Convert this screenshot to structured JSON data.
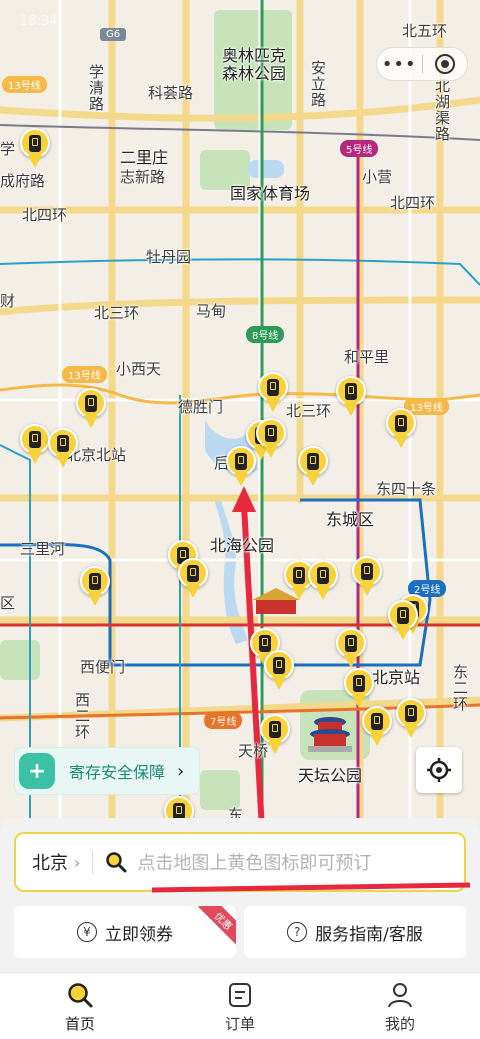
{
  "status": {
    "time": "18:34"
  },
  "map": {
    "labels": {
      "north5": "北五环",
      "olympic1": "奥林匹克",
      "olympic2": "森林公园",
      "anli": "安立路",
      "xuetang": "学清路",
      "kehui": "科荟路",
      "beihu": "北湖渠路",
      "erli": "二里庄",
      "zhixin": "志新路",
      "chengfu": "成府路",
      "stadium": "国家体育场",
      "xiaoying": "小营",
      "north4w": "北四环",
      "north4e": "北四环",
      "mudan": "牡丹园",
      "madian": "马甸",
      "north3w": "北三环",
      "north3e": "北三环",
      "xiaoxi": "小西天",
      "heping": "和平里",
      "deshengmen": "德胜门",
      "bjnorth": "北京北站",
      "dongsi": "东四十条",
      "dongcheng": "东城区",
      "beihai": "北海公园",
      "sanlihe": "三里河",
      "xizhimen": "西便门",
      "beijingstation": "北京站",
      "tiantan": "天坛公园",
      "xi2": "西二环",
      "dong2": "东二环",
      "tianqiao": "天桥",
      "xue": "学",
      "qu": "区",
      "cai": "财",
      "hou": "后",
      "dongtwo": "东"
    },
    "badges": {
      "l13a": "13号线",
      "l13b": "13号线",
      "l13c": "13号线",
      "l5": "5号线",
      "l8": "8号线",
      "l2": "2号线",
      "l7": "7号线",
      "g6": "G6"
    },
    "colors": {
      "pin": "#f7d23a",
      "route_arrow": "#e6293f",
      "line13": "#f5b94a",
      "line5": "#b5287d",
      "line8": "#2e9b57",
      "line2": "#1b70c0",
      "line7": "#e8732a"
    }
  },
  "mini_program": {
    "more_icon": "more-dots-icon",
    "close_icon": "target-circle-icon"
  },
  "guarantee": {
    "label": "寄存安全保障",
    "icon": "shield-plus-icon"
  },
  "locate": {
    "icon": "locate-crosshair-icon"
  },
  "search": {
    "city": "北京",
    "placeholder": "点击地图上黄色图标即可预订"
  },
  "actions": {
    "coupon": {
      "label": "立即领券",
      "ribbon": "优惠",
      "icon": "yen-circle-icon"
    },
    "service": {
      "label": "服务指南/客服",
      "icon": "question-circle-icon"
    }
  },
  "tabs": [
    {
      "label": "首页",
      "icon": "search-icon",
      "active": true
    },
    {
      "label": "订单",
      "icon": "order-list-icon",
      "active": false
    },
    {
      "label": "我的",
      "icon": "user-icon",
      "active": false
    }
  ]
}
